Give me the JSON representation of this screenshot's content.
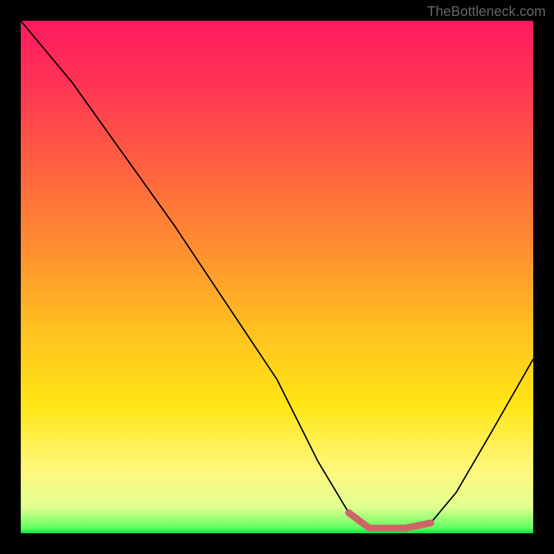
{
  "watermark": "TheBottleneck.com",
  "chart_data": {
    "type": "line",
    "title": "",
    "xlabel": "",
    "ylabel": "",
    "xlim": [
      0,
      100
    ],
    "ylim": [
      0,
      100
    ],
    "curve_points": [
      {
        "x": 0,
        "y": 100
      },
      {
        "x": 10,
        "y": 88
      },
      {
        "x": 20,
        "y": 74
      },
      {
        "x": 30,
        "y": 60
      },
      {
        "x": 40,
        "y": 45
      },
      {
        "x": 50,
        "y": 30
      },
      {
        "x": 58,
        "y": 14
      },
      {
        "x": 64,
        "y": 4
      },
      {
        "x": 68,
        "y": 1
      },
      {
        "x": 75,
        "y": 1
      },
      {
        "x": 80,
        "y": 2
      },
      {
        "x": 85,
        "y": 8
      },
      {
        "x": 92,
        "y": 20
      },
      {
        "x": 100,
        "y": 34
      }
    ],
    "highlight_segment": {
      "start_x": 64,
      "end_x": 82,
      "color": "#cc6666"
    },
    "gradient_stops": [
      {
        "offset": 0,
        "color": "#ff1a5e"
      },
      {
        "offset": 12,
        "color": "#ff3355"
      },
      {
        "offset": 28,
        "color": "#ff6040"
      },
      {
        "offset": 45,
        "color": "#ff9030"
      },
      {
        "offset": 60,
        "color": "#ffc020"
      },
      {
        "offset": 75,
        "color": "#ffe615"
      },
      {
        "offset": 88,
        "color": "#fff880"
      },
      {
        "offset": 95,
        "color": "#e0ff90"
      },
      {
        "offset": 99,
        "color": "#60ff60"
      },
      {
        "offset": 100,
        "color": "#00e840"
      }
    ]
  }
}
